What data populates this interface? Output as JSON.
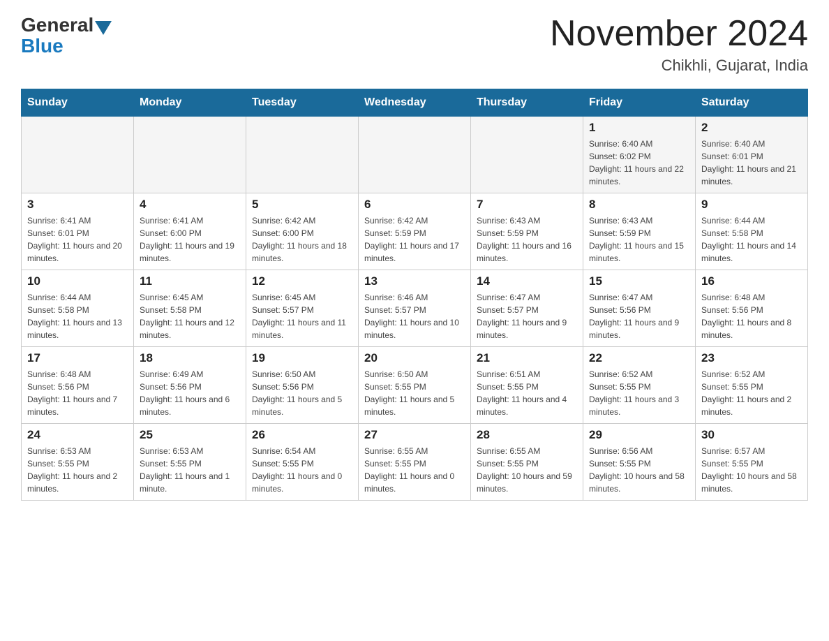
{
  "header": {
    "logo_general": "General",
    "logo_blue": "Blue",
    "title": "November 2024",
    "location": "Chikhli, Gujarat, India"
  },
  "days_of_week": [
    "Sunday",
    "Monday",
    "Tuesday",
    "Wednesday",
    "Thursday",
    "Friday",
    "Saturday"
  ],
  "weeks": [
    [
      {
        "day": "",
        "info": ""
      },
      {
        "day": "",
        "info": ""
      },
      {
        "day": "",
        "info": ""
      },
      {
        "day": "",
        "info": ""
      },
      {
        "day": "",
        "info": ""
      },
      {
        "day": "1",
        "info": "Sunrise: 6:40 AM\nSunset: 6:02 PM\nDaylight: 11 hours and 22 minutes."
      },
      {
        "day": "2",
        "info": "Sunrise: 6:40 AM\nSunset: 6:01 PM\nDaylight: 11 hours and 21 minutes."
      }
    ],
    [
      {
        "day": "3",
        "info": "Sunrise: 6:41 AM\nSunset: 6:01 PM\nDaylight: 11 hours and 20 minutes."
      },
      {
        "day": "4",
        "info": "Sunrise: 6:41 AM\nSunset: 6:00 PM\nDaylight: 11 hours and 19 minutes."
      },
      {
        "day": "5",
        "info": "Sunrise: 6:42 AM\nSunset: 6:00 PM\nDaylight: 11 hours and 18 minutes."
      },
      {
        "day": "6",
        "info": "Sunrise: 6:42 AM\nSunset: 5:59 PM\nDaylight: 11 hours and 17 minutes."
      },
      {
        "day": "7",
        "info": "Sunrise: 6:43 AM\nSunset: 5:59 PM\nDaylight: 11 hours and 16 minutes."
      },
      {
        "day": "8",
        "info": "Sunrise: 6:43 AM\nSunset: 5:59 PM\nDaylight: 11 hours and 15 minutes."
      },
      {
        "day": "9",
        "info": "Sunrise: 6:44 AM\nSunset: 5:58 PM\nDaylight: 11 hours and 14 minutes."
      }
    ],
    [
      {
        "day": "10",
        "info": "Sunrise: 6:44 AM\nSunset: 5:58 PM\nDaylight: 11 hours and 13 minutes."
      },
      {
        "day": "11",
        "info": "Sunrise: 6:45 AM\nSunset: 5:58 PM\nDaylight: 11 hours and 12 minutes."
      },
      {
        "day": "12",
        "info": "Sunrise: 6:45 AM\nSunset: 5:57 PM\nDaylight: 11 hours and 11 minutes."
      },
      {
        "day": "13",
        "info": "Sunrise: 6:46 AM\nSunset: 5:57 PM\nDaylight: 11 hours and 10 minutes."
      },
      {
        "day": "14",
        "info": "Sunrise: 6:47 AM\nSunset: 5:57 PM\nDaylight: 11 hours and 9 minutes."
      },
      {
        "day": "15",
        "info": "Sunrise: 6:47 AM\nSunset: 5:56 PM\nDaylight: 11 hours and 9 minutes."
      },
      {
        "day": "16",
        "info": "Sunrise: 6:48 AM\nSunset: 5:56 PM\nDaylight: 11 hours and 8 minutes."
      }
    ],
    [
      {
        "day": "17",
        "info": "Sunrise: 6:48 AM\nSunset: 5:56 PM\nDaylight: 11 hours and 7 minutes."
      },
      {
        "day": "18",
        "info": "Sunrise: 6:49 AM\nSunset: 5:56 PM\nDaylight: 11 hours and 6 minutes."
      },
      {
        "day": "19",
        "info": "Sunrise: 6:50 AM\nSunset: 5:56 PM\nDaylight: 11 hours and 5 minutes."
      },
      {
        "day": "20",
        "info": "Sunrise: 6:50 AM\nSunset: 5:55 PM\nDaylight: 11 hours and 5 minutes."
      },
      {
        "day": "21",
        "info": "Sunrise: 6:51 AM\nSunset: 5:55 PM\nDaylight: 11 hours and 4 minutes."
      },
      {
        "day": "22",
        "info": "Sunrise: 6:52 AM\nSunset: 5:55 PM\nDaylight: 11 hours and 3 minutes."
      },
      {
        "day": "23",
        "info": "Sunrise: 6:52 AM\nSunset: 5:55 PM\nDaylight: 11 hours and 2 minutes."
      }
    ],
    [
      {
        "day": "24",
        "info": "Sunrise: 6:53 AM\nSunset: 5:55 PM\nDaylight: 11 hours and 2 minutes."
      },
      {
        "day": "25",
        "info": "Sunrise: 6:53 AM\nSunset: 5:55 PM\nDaylight: 11 hours and 1 minute."
      },
      {
        "day": "26",
        "info": "Sunrise: 6:54 AM\nSunset: 5:55 PM\nDaylight: 11 hours and 0 minutes."
      },
      {
        "day": "27",
        "info": "Sunrise: 6:55 AM\nSunset: 5:55 PM\nDaylight: 11 hours and 0 minutes."
      },
      {
        "day": "28",
        "info": "Sunrise: 6:55 AM\nSunset: 5:55 PM\nDaylight: 10 hours and 59 minutes."
      },
      {
        "day": "29",
        "info": "Sunrise: 6:56 AM\nSunset: 5:55 PM\nDaylight: 10 hours and 58 minutes."
      },
      {
        "day": "30",
        "info": "Sunrise: 6:57 AM\nSunset: 5:55 PM\nDaylight: 10 hours and 58 minutes."
      }
    ]
  ]
}
